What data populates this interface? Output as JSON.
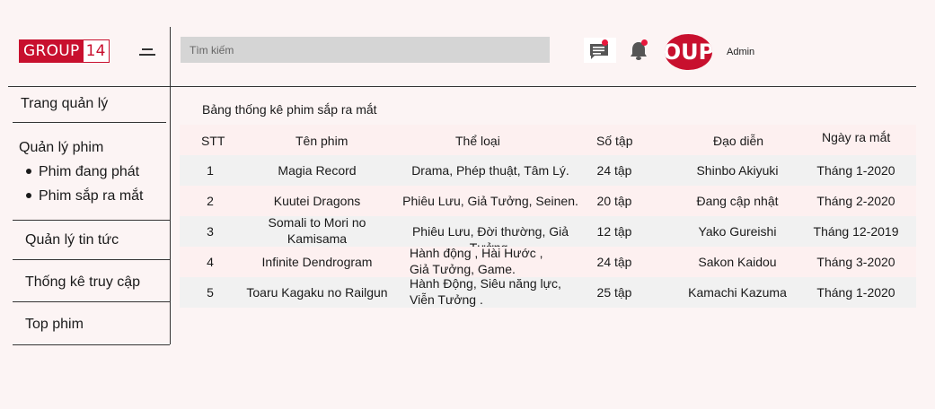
{
  "header": {
    "logo_part1": "GROUP",
    "logo_part2": "14",
    "search_placeholder": "Tìm kiếm",
    "avatar_text": "OUP",
    "user_name": "Admin"
  },
  "sidebar": {
    "dashboard": "Trang quản lý",
    "movies_section": "Quản lý phim",
    "movies_sub": [
      "Phim đang phát",
      "Phim sắp ra mắt"
    ],
    "news": "Quản lý tin tức",
    "stats": "Thống kê truy cập",
    "top": "Top phim"
  },
  "table": {
    "title": "Bảng thống kê phim sắp ra mắt",
    "headers": [
      "STT",
      "Tên phim",
      "Thể loại",
      "Số tập",
      "Đạo diễn",
      "Ngày ra mắt"
    ],
    "rows": [
      {
        "stt": "1",
        "name": [
          "Magia Record"
        ],
        "genre": [
          "Drama, Phép thuật, Tâm Lý."
        ],
        "episodes": "24 tập",
        "director": "Shinbo Akiyuki",
        "release": "Tháng 1-2020"
      },
      {
        "stt": "2",
        "name": [
          "Kuutei Dragons"
        ],
        "genre": [
          "Phiêu Lưu, Giả Tưởng, Seinen."
        ],
        "episodes": "20 tập",
        "director": "Đang cập nhật",
        "release": "Tháng 2-2020"
      },
      {
        "stt": "3",
        "name": [
          "Somali to Mori no",
          "Kamisama"
        ],
        "genre": [
          "Phiêu Lưu, Đời thường, Giả Tưởng."
        ],
        "episodes": "12 tập",
        "director": "Yako Gureishi",
        "release": "Tháng 12-2019"
      },
      {
        "stt": "4",
        "name": [
          "Infinite Dendrogram"
        ],
        "genre": [
          "Hành động , Hài Hước ,",
          "Giả Tưởng, Game."
        ],
        "episodes": "24 tập",
        "director": "Sakon Kaidou",
        "release": "Tháng 3-2020"
      },
      {
        "stt": "5",
        "name": [
          "Toaru Kagaku no Railgun"
        ],
        "genre": [
          "Hành Động, Siêu năng lực,",
          "Viễn Tưởng ."
        ],
        "episodes": "25 tập",
        "director": "Kamachi Kazuma",
        "release": "Tháng 1-2020"
      }
    ]
  },
  "colors": {
    "brand": "#c8102e",
    "notification_dot": "#e8173c",
    "row_odd": "#f1f1f1",
    "row_even": "#fdf0f0"
  }
}
